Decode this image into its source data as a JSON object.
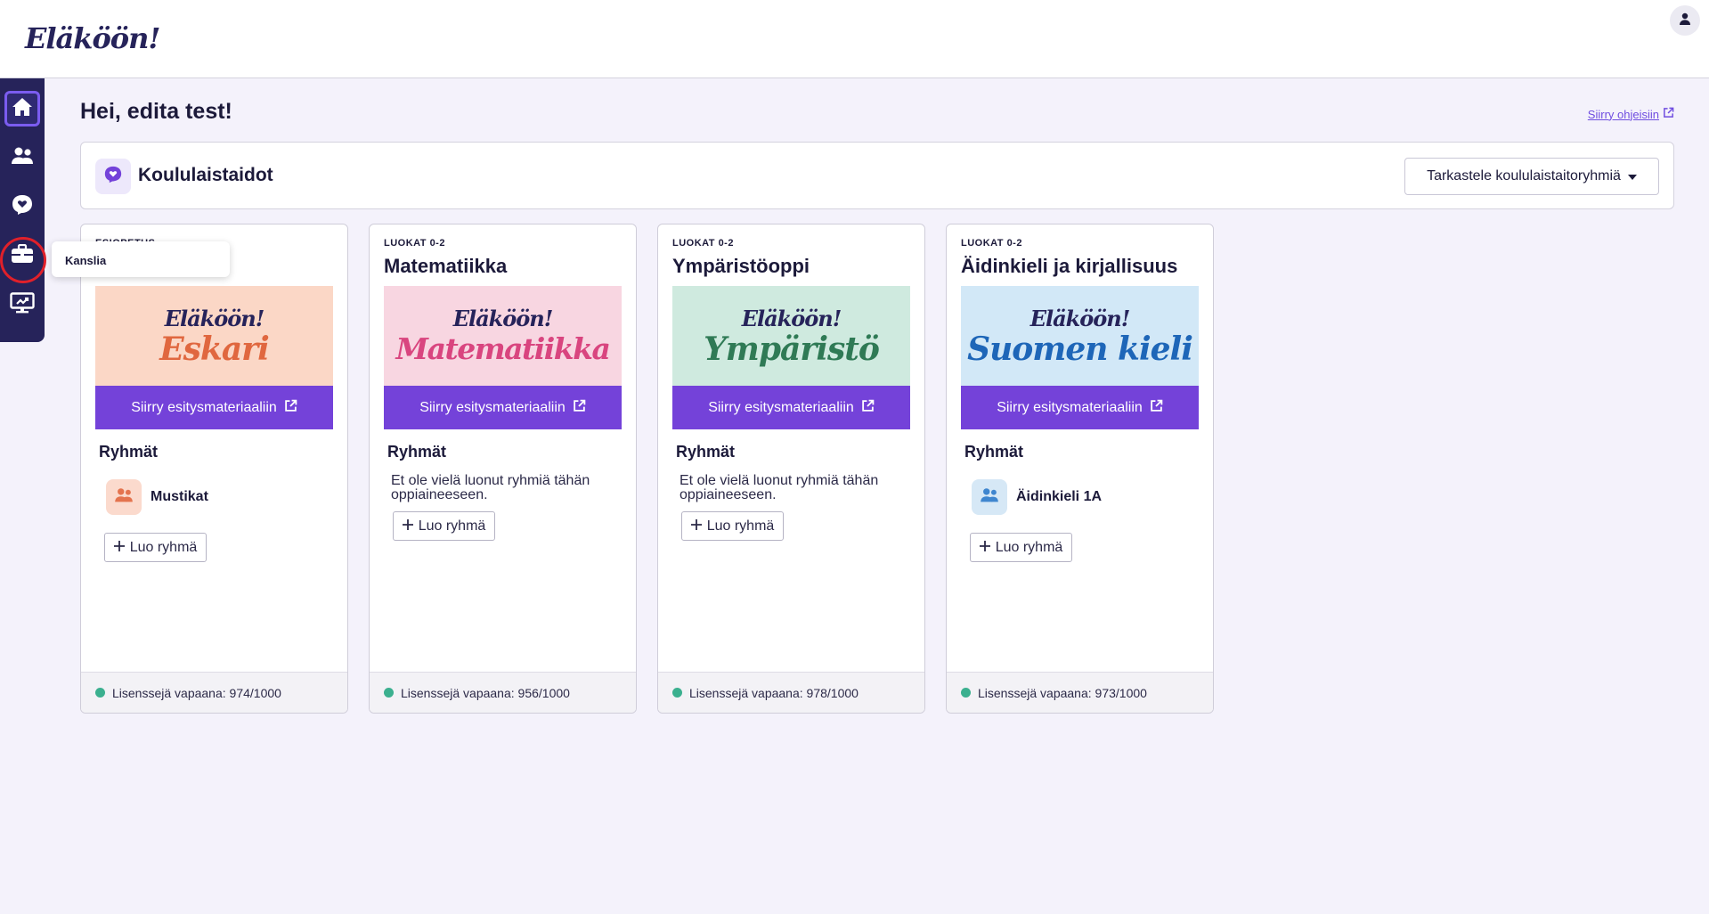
{
  "header": {
    "logo": "Eläköön!",
    "user_icon": "user-icon"
  },
  "sidebar": {
    "items": [
      {
        "name": "home",
        "icon": "home-icon",
        "active": true
      },
      {
        "name": "groups",
        "icon": "users-icon"
      },
      {
        "name": "skills",
        "icon": "heart-badge-icon"
      },
      {
        "name": "office",
        "icon": "briefcase-icon"
      },
      {
        "name": "presentation",
        "icon": "screen-icon"
      }
    ],
    "tooltip": "Kanslia"
  },
  "main": {
    "greeting": "Hei, edita test!",
    "help_link": "Siirry ohjeisiin",
    "panel": {
      "title": "Koululaistaidot",
      "button_label": "Tarkastele koululaistaitoryhmiä"
    },
    "cards": [
      {
        "eyebrow": "ESIOPETUS",
        "title": "",
        "banner_top": "Eläköön!",
        "banner_word": "Eskari",
        "banner_button": "Siirry esitysmateriaaliin",
        "groups_title": "Ryhmät",
        "groups": [
          "Mustikat"
        ],
        "empty_text": "",
        "add_label": "Luo ryhmä",
        "footer": "Lisenssejä vapaana: 974/1000",
        "colors": {
          "bg": "#fbd7c6",
          "word": "#e0673f",
          "avatar": "#fbdacd",
          "avatar_icon": "#e4734e"
        }
      },
      {
        "eyebrow": "LUOKAT 0-2",
        "title": "Matematiikka",
        "banner_top": "Eläköön!",
        "banner_word": "Matematiikka",
        "banner_button": "Siirry esitysmateriaaliin",
        "groups_title": "Ryhmät",
        "groups": [],
        "empty_text": "Et ole vielä luonut ryhmiä tähän oppiaineeseen.",
        "add_label": "Luo ryhmä",
        "footer": "Lisenssejä vapaana: 956/1000",
        "colors": {
          "bg": "#f8d6e1",
          "word": "#d9457f"
        }
      },
      {
        "eyebrow": "LUOKAT 0-2",
        "title": "Ympäristöoppi",
        "banner_top": "Eläköön!",
        "banner_word": "Ympäristö",
        "banner_button": "Siirry esitysmateriaaliin",
        "groups_title": "Ryhmät",
        "groups": [],
        "empty_text": "Et ole vielä luonut ryhmiä tähän oppiaineeseen.",
        "add_label": "Luo ryhmä",
        "footer": "Lisenssejä vapaana: 978/1000",
        "colors": {
          "bg": "#cfeadf",
          "word": "#2f7a55"
        }
      },
      {
        "eyebrow": "LUOKAT 0-2",
        "title": "Äidinkieli ja kirjallisuus",
        "banner_top": "Eläköön!",
        "banner_word": "Suomen kieli",
        "banner_button": "Siirry esitysmateriaaliin",
        "groups_title": "Ryhmät",
        "groups": [
          "Äidinkieli 1A"
        ],
        "empty_text": "",
        "add_label": "Luo ryhmä",
        "footer": "Lisenssejä vapaana: 973/1000",
        "colors": {
          "bg": "#d2e8f7",
          "word": "#1e66b8",
          "avatar": "#d6e8f6",
          "avatar_icon": "#3f86cf"
        }
      }
    ]
  },
  "colors": {
    "accent": "#7442d9",
    "nav": "#26235a",
    "highlight": "#e0202a",
    "status": "#3bb08f"
  }
}
